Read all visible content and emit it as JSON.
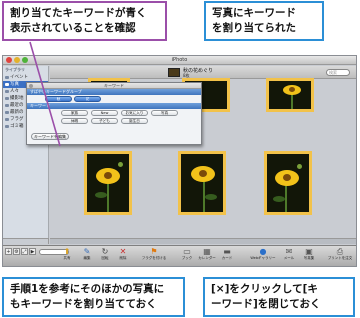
{
  "callouts": {
    "top_left": "割り当てたキーワードが青く\n表示されていることを確認",
    "top_right": "写真にキーワード\nを割り当てられた",
    "bottom_left": "手順1を参考にそのほかの写真に\nもキーワードを割り当てておく",
    "bottom_right": "[×]をクリックして[キ\nーワード]を閉じておく"
  },
  "window": {
    "title": "iPhoto"
  },
  "sidebar": {
    "header": "ライブラリ",
    "items": [
      "イベント",
      "写真",
      "人々",
      "撮影地",
      "最近の",
      "最新の",
      "フラグ",
      "ゴミ箱"
    ]
  },
  "event": {
    "name": "秋の花めぐり",
    "count": "8枚",
    "search_placeholder": "検索"
  },
  "keyword_dialog": {
    "title": "キーワード",
    "quick_group_label": "すばやいキーワードグループ",
    "keywords_label": "キーワード",
    "quick_buttons": [
      "秋",
      "花"
    ],
    "row1": [
      "家族",
      "New",
      "お気に入り",
      "写真"
    ],
    "row2": [
      "休暇",
      "子ども",
      "誕生日",
      ""
    ],
    "edit_button": "キーワードを編集"
  },
  "toolbar": {
    "tools": [
      {
        "label": "共有",
        "icon": "share-icon"
      },
      {
        "label": "編集",
        "icon": "edit-icon"
      },
      {
        "label": "回転",
        "icon": "rotate-icon"
      },
      {
        "label": "削除",
        "icon": "delete-icon"
      },
      {
        "label": "フラグを付ける",
        "icon": "flag-icon"
      },
      {
        "label": "ブック",
        "icon": "book-icon"
      },
      {
        "label": "カレンダー",
        "icon": "calendar-icon"
      },
      {
        "label": "カード",
        "icon": "card-icon"
      },
      {
        "label": "Webギャラリー",
        "icon": "globe-icon"
      },
      {
        "label": "メール",
        "icon": "mail-icon"
      },
      {
        "label": "写真集",
        "icon": "photo-icon"
      },
      {
        "label": "プリントを注文",
        "icon": "print-icon"
      }
    ]
  },
  "colors": {
    "callout_border": "#2b8fd6",
    "callout_border_accent": "#9b4fa9",
    "selection": "#3b70c4",
    "frame_highlight": "#f2c24a"
  }
}
